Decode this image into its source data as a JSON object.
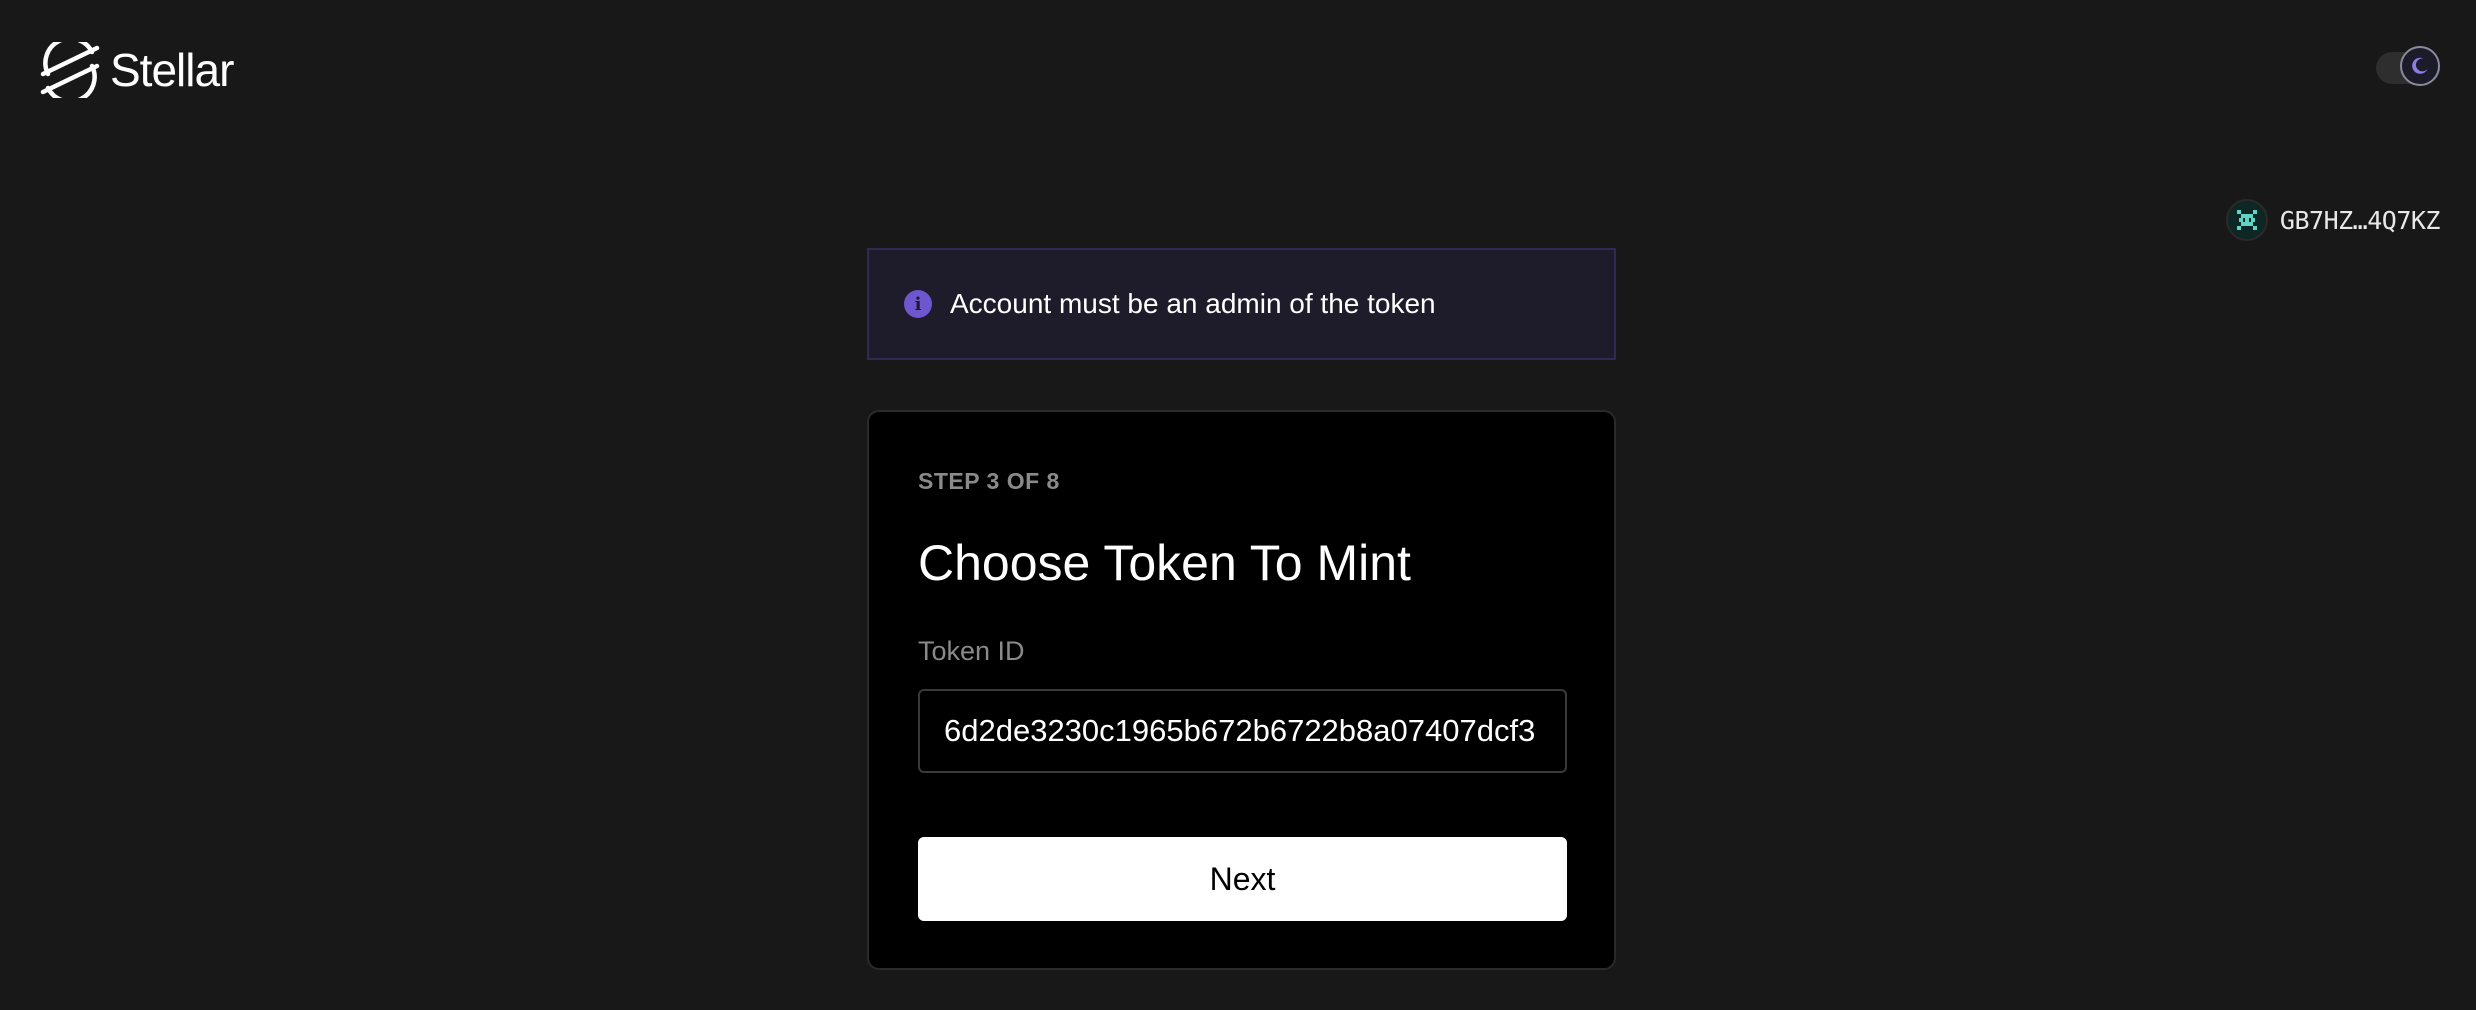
{
  "header": {
    "brand": "Stellar",
    "theme_toggle": {
      "mode": "dark",
      "icon": "moon-icon"
    }
  },
  "account": {
    "avatar_icon": "identicon-avatar",
    "address": "GB7HZ…4Q7KZ"
  },
  "notice": {
    "icon": "info-icon",
    "text": "Account must be an admin of the token"
  },
  "card": {
    "step_label": "STEP 3 OF 8",
    "title": "Choose Token To Mint",
    "field_label": "Token ID",
    "token_id_value": "6d2de3230c1965b672b6722b8a07407dcf3",
    "next_label": "Next"
  },
  "colors": {
    "background": "#181818",
    "card": "#000000",
    "accent": "#6e56cf",
    "notice_bg": "#1e1c2b"
  }
}
